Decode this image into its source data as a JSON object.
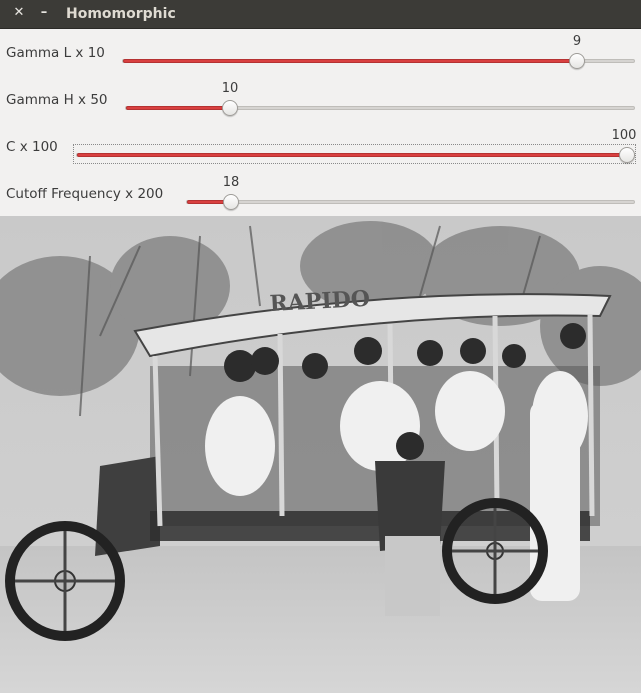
{
  "window": {
    "title": "Homomorphic",
    "close_glyph": "✕",
    "min_glyph": "–"
  },
  "sliders": [
    {
      "label": "Gamma L x 10",
      "value": "9",
      "max": 10,
      "level": 0.9
    },
    {
      "label": "Gamma H x 50",
      "value": "10",
      "max": 50,
      "level": 0.2
    },
    {
      "label": "C x 100",
      "value": "100",
      "max": 100,
      "level": 1.0
    },
    {
      "label": "Cutoff Frequency x 200",
      "value": "18",
      "max": 200,
      "level": 0.09
    }
  ],
  "colors": {
    "accent": "#d94040",
    "titlebar": "#3c3b37",
    "panel": "#f2f1f0"
  },
  "image": {
    "kind": "grayscale-photo",
    "subject": "vintage open bus with passengers",
    "sign_text": "RAPIDO"
  }
}
